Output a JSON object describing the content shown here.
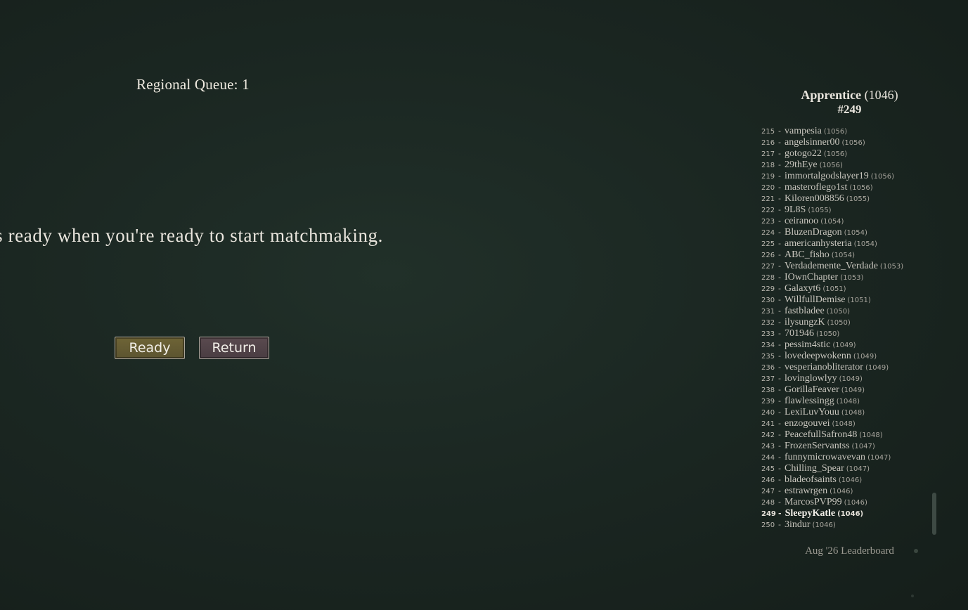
{
  "queue": {
    "label": "Regional Queue: 1"
  },
  "instruction": "ss ready when you're ready to start matchmaking.",
  "buttons": {
    "ready": "Ready",
    "return": "Return"
  },
  "player": {
    "tier": "Apprentice",
    "rating": "(1046)",
    "rank": "#249"
  },
  "leaderboard": {
    "rows": [
      {
        "rank": "215",
        "name": "vampesia",
        "score": "(1056)"
      },
      {
        "rank": "216",
        "name": "angelsinner00",
        "score": "(1056)"
      },
      {
        "rank": "217",
        "name": "gotogo22",
        "score": "(1056)"
      },
      {
        "rank": "218",
        "name": "29thEye",
        "score": "(1056)"
      },
      {
        "rank": "219",
        "name": "immortalgodslayer19",
        "score": "(1056)"
      },
      {
        "rank": "220",
        "name": "masteroflego1st",
        "score": "(1056)"
      },
      {
        "rank": "221",
        "name": "Kiloren008856",
        "score": "(1055)"
      },
      {
        "rank": "222",
        "name": "9L8S",
        "score": "(1055)"
      },
      {
        "rank": "223",
        "name": "ceiranoo",
        "score": "(1054)"
      },
      {
        "rank": "224",
        "name": "BluzenDragon",
        "score": "(1054)"
      },
      {
        "rank": "225",
        "name": "americanhysteria",
        "score": "(1054)"
      },
      {
        "rank": "226",
        "name": "ABC_fisho",
        "score": "(1054)"
      },
      {
        "rank": "227",
        "name": "Verdademente_Verdade",
        "score": "(1053)"
      },
      {
        "rank": "228",
        "name": "IOwnChapter",
        "score": "(1053)"
      },
      {
        "rank": "229",
        "name": "Galaxyt6",
        "score": "(1051)"
      },
      {
        "rank": "230",
        "name": "WillfullDemise",
        "score": "(1051)"
      },
      {
        "rank": "231",
        "name": "fastbladee",
        "score": "(1050)"
      },
      {
        "rank": "232",
        "name": "ilysungzK",
        "score": "(1050)"
      },
      {
        "rank": "233",
        "name": "701946",
        "score": "(1050)"
      },
      {
        "rank": "234",
        "name": "pessim4stic",
        "score": "(1049)"
      },
      {
        "rank": "235",
        "name": "lovedeepwokenn",
        "score": "(1049)"
      },
      {
        "rank": "236",
        "name": "vesperianobliterator",
        "score": "(1049)"
      },
      {
        "rank": "237",
        "name": "lovinglowlyy",
        "score": "(1049)"
      },
      {
        "rank": "238",
        "name": "GorillaFeaver",
        "score": "(1049)"
      },
      {
        "rank": "239",
        "name": "flawlessingg",
        "score": "(1048)"
      },
      {
        "rank": "240",
        "name": "LexiLuvYouu",
        "score": "(1048)"
      },
      {
        "rank": "241",
        "name": "enzogouvei",
        "score": "(1048)"
      },
      {
        "rank": "242",
        "name": "PeacefullSafron48",
        "score": "(1048)"
      },
      {
        "rank": "243",
        "name": "FrozenServantss",
        "score": "(1047)"
      },
      {
        "rank": "244",
        "name": "funnymicrowavevan",
        "score": "(1047)"
      },
      {
        "rank": "245",
        "name": "Chilling_Spear",
        "score": "(1047)"
      },
      {
        "rank": "246",
        "name": "bladeofsaints",
        "score": "(1046)"
      },
      {
        "rank": "247",
        "name": "estrawrgen",
        "score": "(1046)"
      },
      {
        "rank": "248",
        "name": "MarcosPVP99",
        "score": "(1046)"
      },
      {
        "rank": "249",
        "name": "SleepyKatle",
        "score": "(1046)",
        "current": true
      },
      {
        "rank": "250",
        "name": "3indur",
        "score": "(1046)"
      }
    ],
    "footer": "Aug '26 Leaderboard"
  }
}
